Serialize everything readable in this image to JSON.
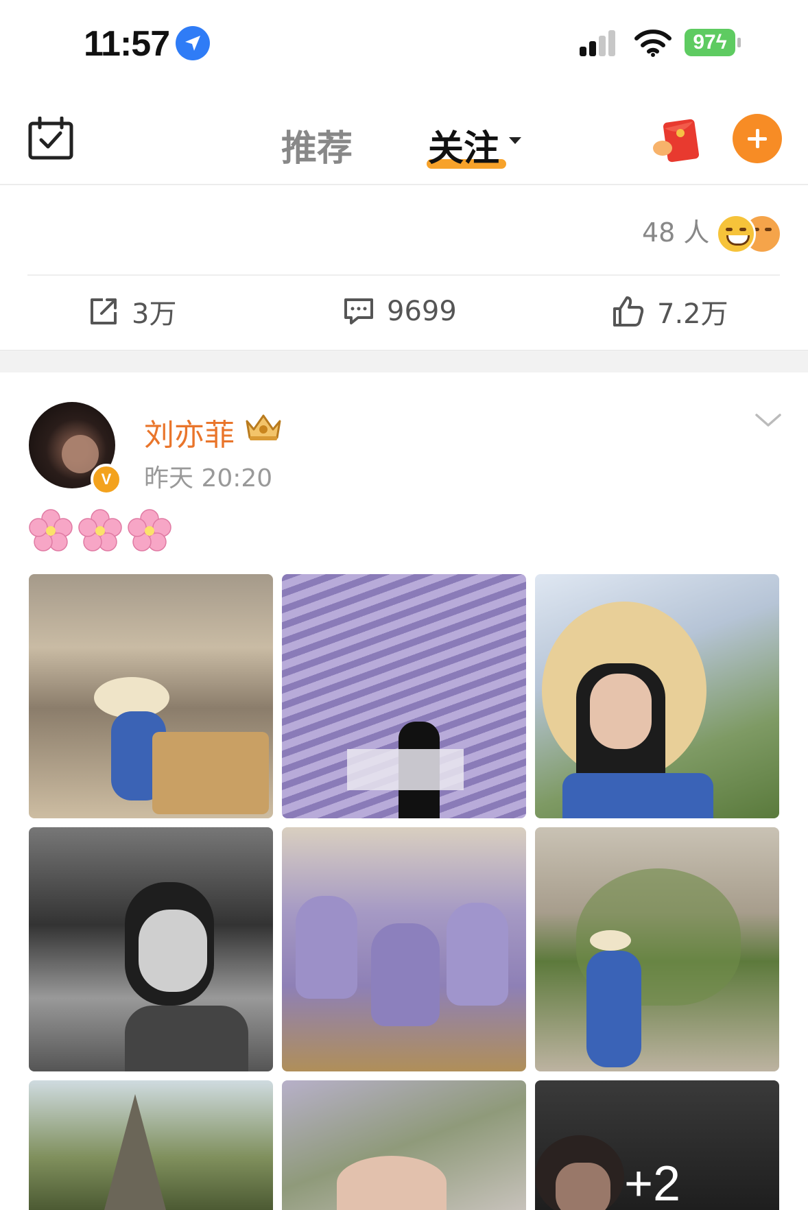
{
  "status_bar": {
    "time": "11:57",
    "battery": "97"
  },
  "nav": {
    "tabs": [
      {
        "label": "推荐",
        "active": false
      },
      {
        "label": "关注",
        "active": true
      }
    ],
    "accent_color": "#f78c25"
  },
  "prev_post": {
    "reactors_count": "48 人",
    "actions": {
      "repost": "3万",
      "comment": "9699",
      "like": "7.2万"
    }
  },
  "post": {
    "author": "刘亦菲",
    "time": "昨天 20:20",
    "verified_badge": "V",
    "text_emojis": [
      "cherry-blossom",
      "cherry-blossom",
      "cherry-blossom"
    ],
    "photos_more": "+2",
    "name_color": "#e9752b"
  },
  "icons": [
    "location-arrow-icon",
    "signal-icon",
    "wifi-icon",
    "battery-icon",
    "calendar-check-icon",
    "red-packet-icon",
    "add-icon",
    "repost-icon",
    "comment-icon",
    "like-icon",
    "crown-icon",
    "chevron-down-icon",
    "cherry-blossom-icon"
  ]
}
